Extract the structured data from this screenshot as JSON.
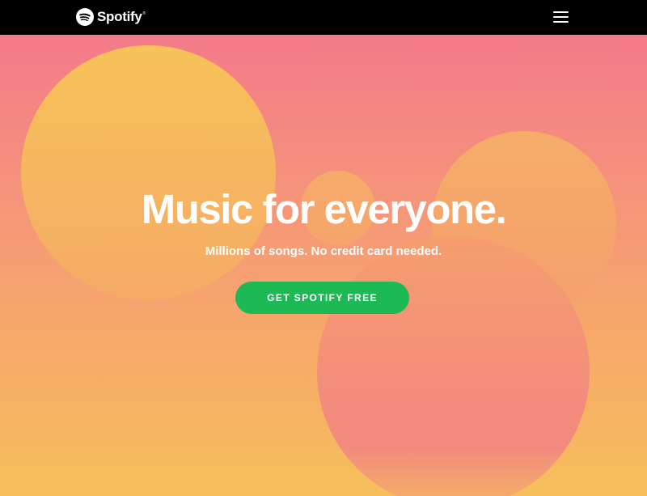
{
  "navbar": {
    "logo_text": "Spotify",
    "logo_trademark": "®",
    "logo_icon": "spotify-logo-icon",
    "menu_icon": "hamburger-menu-icon"
  },
  "hero": {
    "headline": "Music for everyone.",
    "subheadline": "Millions of songs. No credit card needed.",
    "cta_label": "GET SPOTIFY FREE"
  },
  "colors": {
    "navbar_background": "#000000",
    "cta_background": "#1db954",
    "gradient_top": "#f37a8a",
    "gradient_bottom": "#f6bd5c",
    "text": "#ffffff"
  }
}
